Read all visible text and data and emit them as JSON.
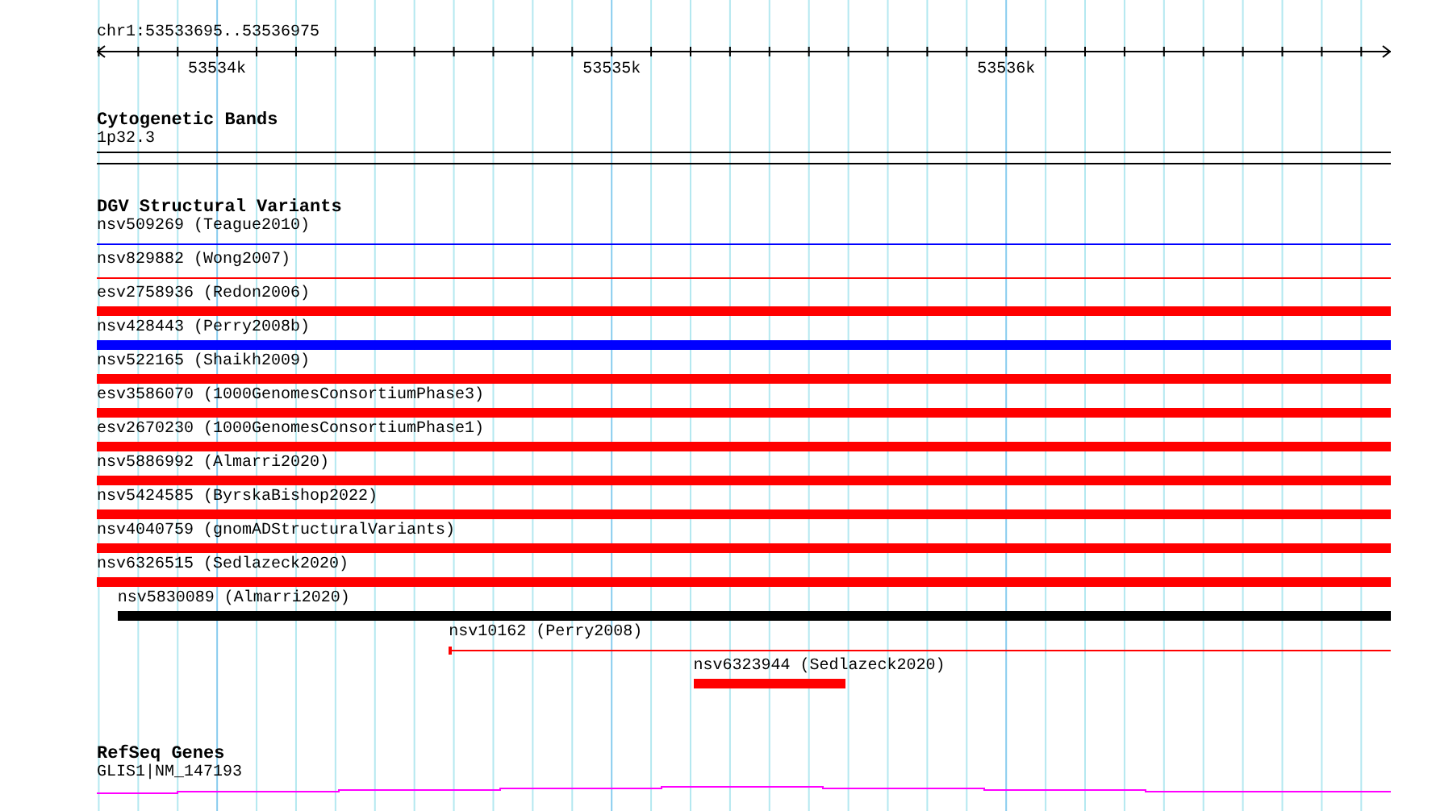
{
  "ruler": {
    "label": "chr1:53533695..53536975",
    "ticks": [
      {
        "label": "53534k"
      },
      {
        "label": "53535k"
      },
      {
        "label": "53536k"
      }
    ]
  },
  "tracks": [
    {
      "kind": "cytoband",
      "title": "Cytogenetic Bands",
      "features": [
        {
          "label": "1p32.3"
        }
      ]
    },
    {
      "kind": "variants",
      "title": "DGV Structural Variants",
      "features": [
        {
          "label": "nsv509269 (Teague2010)",
          "kind": "thin",
          "color": "#0000ff"
        },
        {
          "label": "nsv829882 (Wong2007)",
          "kind": "thin",
          "color": "#ff0000"
        },
        {
          "label": "esv2758936 (Redon2006)",
          "kind": "thick",
          "color": "#ff0000"
        },
        {
          "label": "nsv428443 (Perry2008b)",
          "kind": "thick",
          "color": "#0000ff"
        },
        {
          "label": "nsv522165 (Shaikh2009)",
          "kind": "thick",
          "color": "#ff0000"
        },
        {
          "label": "esv3586070 (1000GenomesConsortiumPhase3)",
          "kind": "thick",
          "color": "#ff0000"
        },
        {
          "label": "esv2670230 (1000GenomesConsortiumPhase1)",
          "kind": "thick",
          "color": "#ff0000"
        },
        {
          "label": "nsv5886992 (Almarri2020)",
          "kind": "thick",
          "color": "#ff0000"
        },
        {
          "label": "nsv5424585 (ByrskaBishop2022)",
          "kind": "thick",
          "color": "#ff0000"
        },
        {
          "label": "nsv4040759 (gnomADStructuralVariants)",
          "kind": "thick",
          "color": "#ff0000"
        },
        {
          "label": "nsv6326515 (Sedlazeck2020)",
          "kind": "thick",
          "color": "#ff0000"
        },
        {
          "label": "nsv5830089 (Almarri2020)",
          "kind": "thick",
          "color": "#000000"
        },
        {
          "label": "nsv10162 (Perry2008)",
          "kind": "capped",
          "color": "#ff0000"
        },
        {
          "label": "nsv6323944 (Sedlazeck2020)",
          "kind": "thick",
          "color": "#ff0000"
        }
      ]
    },
    {
      "kind": "genes",
      "title": "RefSeq Genes",
      "features": [
        {
          "label": "GLIS1|NM_147193"
        }
      ]
    }
  ]
}
